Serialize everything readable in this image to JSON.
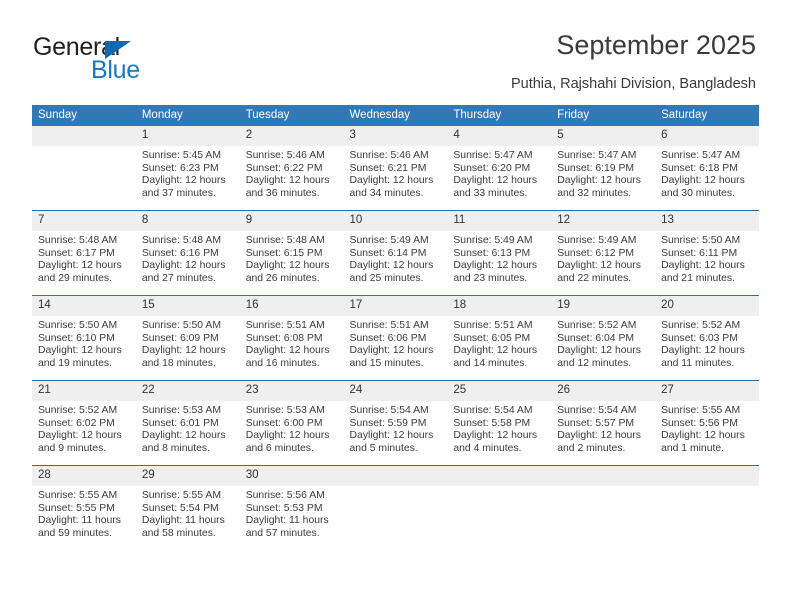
{
  "brand": {
    "name_top": "General",
    "name_bottom": "Blue",
    "color_dark": "#231f20",
    "color_blue": "#1d76c4"
  },
  "header": {
    "title": "September 2025",
    "subtitle": "Puthia, Rajshahi Division, Bangladesh"
  },
  "theme": {
    "header_bg": "#3179b6",
    "daynum_bg": "#efefef",
    "border": "#2c6ea5",
    "text": "#3c3c3c"
  },
  "weekday_headers": [
    "Sunday",
    "Monday",
    "Tuesday",
    "Wednesday",
    "Thursday",
    "Friday",
    "Saturday"
  ],
  "weeks": [
    [
      {
        "day": "",
        "sunrise": "",
        "sunset": "",
        "daylight1": "",
        "daylight2": "",
        "blank": true
      },
      {
        "day": "1",
        "sunrise": "Sunrise: 5:45 AM",
        "sunset": "Sunset: 6:23 PM",
        "daylight1": "Daylight: 12 hours",
        "daylight2": "and 37 minutes."
      },
      {
        "day": "2",
        "sunrise": "Sunrise: 5:46 AM",
        "sunset": "Sunset: 6:22 PM",
        "daylight1": "Daylight: 12 hours",
        "daylight2": "and 36 minutes."
      },
      {
        "day": "3",
        "sunrise": "Sunrise: 5:46 AM",
        "sunset": "Sunset: 6:21 PM",
        "daylight1": "Daylight: 12 hours",
        "daylight2": "and 34 minutes."
      },
      {
        "day": "4",
        "sunrise": "Sunrise: 5:47 AM",
        "sunset": "Sunset: 6:20 PM",
        "daylight1": "Daylight: 12 hours",
        "daylight2": "and 33 minutes."
      },
      {
        "day": "5",
        "sunrise": "Sunrise: 5:47 AM",
        "sunset": "Sunset: 6:19 PM",
        "daylight1": "Daylight: 12 hours",
        "daylight2": "and 32 minutes."
      },
      {
        "day": "6",
        "sunrise": "Sunrise: 5:47 AM",
        "sunset": "Sunset: 6:18 PM",
        "daylight1": "Daylight: 12 hours",
        "daylight2": "and 30 minutes."
      }
    ],
    [
      {
        "day": "7",
        "sunrise": "Sunrise: 5:48 AM",
        "sunset": "Sunset: 6:17 PM",
        "daylight1": "Daylight: 12 hours",
        "daylight2": "and 29 minutes."
      },
      {
        "day": "8",
        "sunrise": "Sunrise: 5:48 AM",
        "sunset": "Sunset: 6:16 PM",
        "daylight1": "Daylight: 12 hours",
        "daylight2": "and 27 minutes."
      },
      {
        "day": "9",
        "sunrise": "Sunrise: 5:48 AM",
        "sunset": "Sunset: 6:15 PM",
        "daylight1": "Daylight: 12 hours",
        "daylight2": "and 26 minutes."
      },
      {
        "day": "10",
        "sunrise": "Sunrise: 5:49 AM",
        "sunset": "Sunset: 6:14 PM",
        "daylight1": "Daylight: 12 hours",
        "daylight2": "and 25 minutes."
      },
      {
        "day": "11",
        "sunrise": "Sunrise: 5:49 AM",
        "sunset": "Sunset: 6:13 PM",
        "daylight1": "Daylight: 12 hours",
        "daylight2": "and 23 minutes."
      },
      {
        "day": "12",
        "sunrise": "Sunrise: 5:49 AM",
        "sunset": "Sunset: 6:12 PM",
        "daylight1": "Daylight: 12 hours",
        "daylight2": "and 22 minutes."
      },
      {
        "day": "13",
        "sunrise": "Sunrise: 5:50 AM",
        "sunset": "Sunset: 6:11 PM",
        "daylight1": "Daylight: 12 hours",
        "daylight2": "and 21 minutes."
      }
    ],
    [
      {
        "day": "14",
        "sunrise": "Sunrise: 5:50 AM",
        "sunset": "Sunset: 6:10 PM",
        "daylight1": "Daylight: 12 hours",
        "daylight2": "and 19 minutes."
      },
      {
        "day": "15",
        "sunrise": "Sunrise: 5:50 AM",
        "sunset": "Sunset: 6:09 PM",
        "daylight1": "Daylight: 12 hours",
        "daylight2": "and 18 minutes."
      },
      {
        "day": "16",
        "sunrise": "Sunrise: 5:51 AM",
        "sunset": "Sunset: 6:08 PM",
        "daylight1": "Daylight: 12 hours",
        "daylight2": "and 16 minutes."
      },
      {
        "day": "17",
        "sunrise": "Sunrise: 5:51 AM",
        "sunset": "Sunset: 6:06 PM",
        "daylight1": "Daylight: 12 hours",
        "daylight2": "and 15 minutes."
      },
      {
        "day": "18",
        "sunrise": "Sunrise: 5:51 AM",
        "sunset": "Sunset: 6:05 PM",
        "daylight1": "Daylight: 12 hours",
        "daylight2": "and 14 minutes."
      },
      {
        "day": "19",
        "sunrise": "Sunrise: 5:52 AM",
        "sunset": "Sunset: 6:04 PM",
        "daylight1": "Daylight: 12 hours",
        "daylight2": "and 12 minutes."
      },
      {
        "day": "20",
        "sunrise": "Sunrise: 5:52 AM",
        "sunset": "Sunset: 6:03 PM",
        "daylight1": "Daylight: 12 hours",
        "daylight2": "and 11 minutes."
      }
    ],
    [
      {
        "day": "21",
        "sunrise": "Sunrise: 5:52 AM",
        "sunset": "Sunset: 6:02 PM",
        "daylight1": "Daylight: 12 hours",
        "daylight2": "and 9 minutes."
      },
      {
        "day": "22",
        "sunrise": "Sunrise: 5:53 AM",
        "sunset": "Sunset: 6:01 PM",
        "daylight1": "Daylight: 12 hours",
        "daylight2": "and 8 minutes."
      },
      {
        "day": "23",
        "sunrise": "Sunrise: 5:53 AM",
        "sunset": "Sunset: 6:00 PM",
        "daylight1": "Daylight: 12 hours",
        "daylight2": "and 6 minutes."
      },
      {
        "day": "24",
        "sunrise": "Sunrise: 5:54 AM",
        "sunset": "Sunset: 5:59 PM",
        "daylight1": "Daylight: 12 hours",
        "daylight2": "and 5 minutes."
      },
      {
        "day": "25",
        "sunrise": "Sunrise: 5:54 AM",
        "sunset": "Sunset: 5:58 PM",
        "daylight1": "Daylight: 12 hours",
        "daylight2": "and 4 minutes."
      },
      {
        "day": "26",
        "sunrise": "Sunrise: 5:54 AM",
        "sunset": "Sunset: 5:57 PM",
        "daylight1": "Daylight: 12 hours",
        "daylight2": "and 2 minutes."
      },
      {
        "day": "27",
        "sunrise": "Sunrise: 5:55 AM",
        "sunset": "Sunset: 5:56 PM",
        "daylight1": "Daylight: 12 hours",
        "daylight2": "and 1 minute."
      }
    ],
    [
      {
        "day": "28",
        "sunrise": "Sunrise: 5:55 AM",
        "sunset": "Sunset: 5:55 PM",
        "daylight1": "Daylight: 11 hours",
        "daylight2": "and 59 minutes."
      },
      {
        "day": "29",
        "sunrise": "Sunrise: 5:55 AM",
        "sunset": "Sunset: 5:54 PM",
        "daylight1": "Daylight: 11 hours",
        "daylight2": "and 58 minutes."
      },
      {
        "day": "30",
        "sunrise": "Sunrise: 5:56 AM",
        "sunset": "Sunset: 5:53 PM",
        "daylight1": "Daylight: 11 hours",
        "daylight2": "and 57 minutes."
      },
      {
        "day": "",
        "sunrise": "",
        "sunset": "",
        "daylight1": "",
        "daylight2": "",
        "blank": true
      },
      {
        "day": "",
        "sunrise": "",
        "sunset": "",
        "daylight1": "",
        "daylight2": "",
        "blank": true
      },
      {
        "day": "",
        "sunrise": "",
        "sunset": "",
        "daylight1": "",
        "daylight2": "",
        "blank": true
      },
      {
        "day": "",
        "sunrise": "",
        "sunset": "",
        "daylight1": "",
        "daylight2": "",
        "blank": true
      }
    ]
  ]
}
